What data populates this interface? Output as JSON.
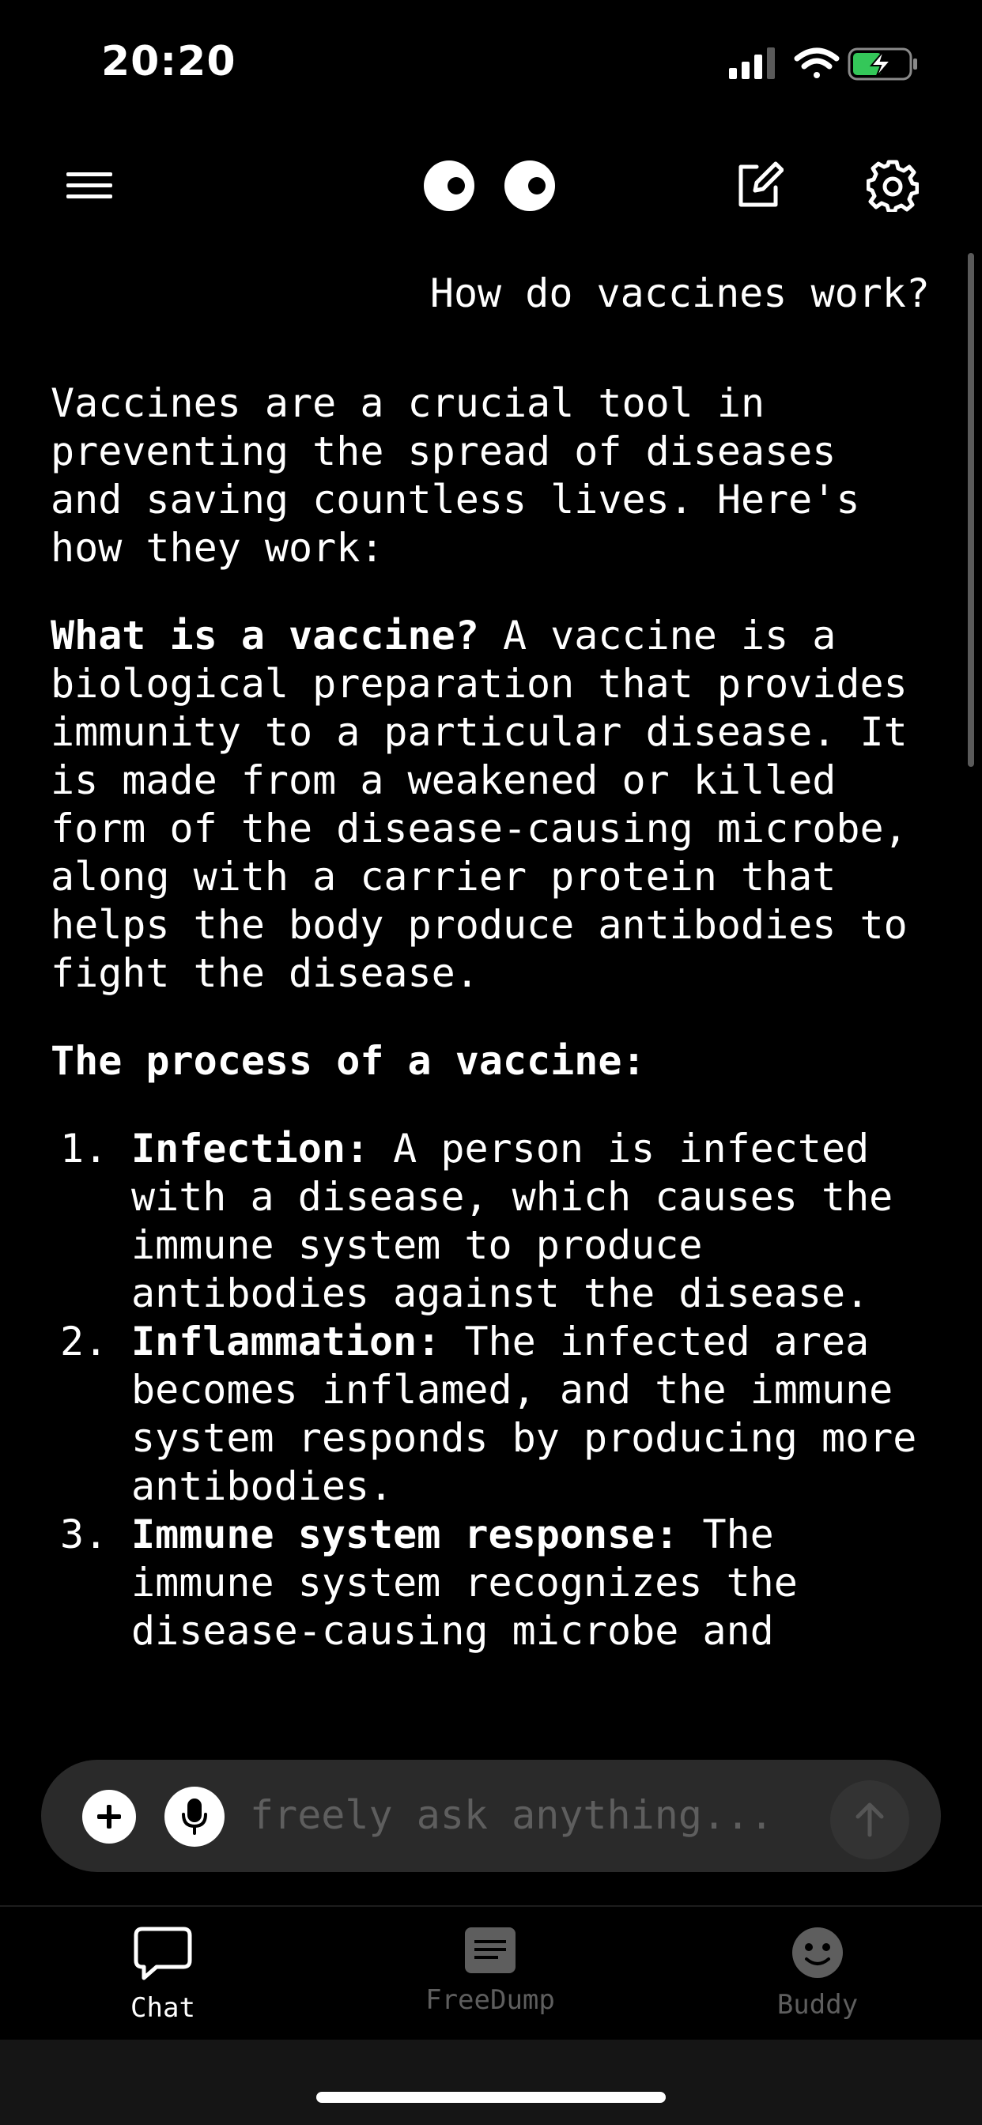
{
  "status": {
    "time": "20:20"
  },
  "header": {
    "menu_icon": "hamburger-menu-icon",
    "logo": "buddy-eyes-logo",
    "new_chat_icon": "compose-icon",
    "settings_icon": "gear-icon"
  },
  "conversation": {
    "user_message": "How do vaccines work?",
    "intro": "Vaccines are a crucial tool in preventing the spread of diseases and saving countless lives. Here's how they work:",
    "what_is_title": "What is a vaccine?",
    "what_is_body": " A vaccine is a biological preparation that provides immunity to a particular disease. It is made from a weakened or killed form of the disease-causing microbe, along with a carrier protein that helps the body produce antibodies to fight the disease.",
    "process_title": "The process of a vaccine:",
    "steps": [
      {
        "number": "1.",
        "title": "Infection:",
        "body": " A person is infected with a disease, which causes the immune system to produce antibodies against the disease."
      },
      {
        "number": "2.",
        "title": "Inflammation:",
        "body": " The infected area becomes inflamed, and the immune system responds by producing more antibodies."
      },
      {
        "number": "3.",
        "title": "Immune system response:",
        "body": " The immune system recognizes the disease-causing microbe and"
      }
    ]
  },
  "composer": {
    "placeholder": "freely ask anything...",
    "add_icon": "plus-icon",
    "mic_icon": "microphone-icon",
    "send_icon": "arrow-up-icon"
  },
  "tabs": [
    {
      "label": "Chat",
      "icon": "chat-bubble-icon",
      "active": true
    },
    {
      "label": "FreeDump",
      "icon": "notes-icon",
      "active": false
    },
    {
      "label": "Buddy",
      "icon": "smiley-icon",
      "active": false
    }
  ],
  "colors": {
    "background": "#000000",
    "text": "#ffffff",
    "muted": "#5e5e5e",
    "composer_bg": "#2a2a2a",
    "battery": "#34c759"
  }
}
